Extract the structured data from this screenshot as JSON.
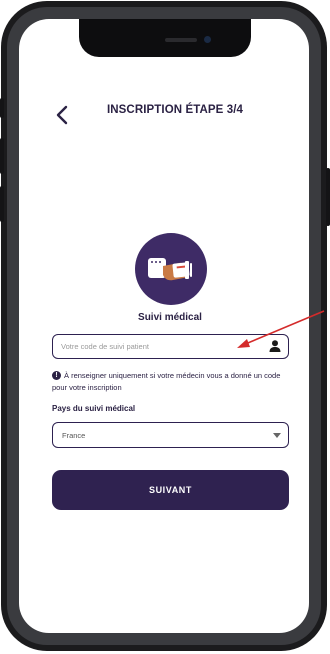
{
  "header": {
    "title": "INSCRIPTION ÉTAPE 3/4"
  },
  "section": {
    "label": "Suivi médical"
  },
  "patient_code": {
    "placeholder": "Votre code de suivi patient",
    "value": ""
  },
  "info_note": {
    "text": "À renseigner uniquement si votre médecin vous a donné un code pour votre inscription"
  },
  "country": {
    "label": "Pays du suivi médical",
    "selected": "France"
  },
  "actions": {
    "next_label": "SUIVANT"
  },
  "colors": {
    "primary": "#2f2250",
    "illustration_bg": "#3e2b66",
    "annotation_arrow": "#d42b2b"
  }
}
